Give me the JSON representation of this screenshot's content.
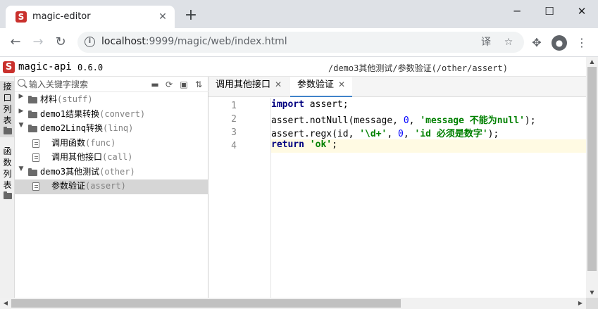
{
  "browser": {
    "tab_title": "magic-editor",
    "tab_favicon": "S",
    "tab_close": "✕",
    "new_tab": "+",
    "window_minimize": "─",
    "window_maximize": "☐",
    "window_close": "✕",
    "nav_back": "←",
    "nav_forward": "→",
    "nav_reload": "↻",
    "url_host": "localhost",
    "url_path": ":9999/magic/web/index.html",
    "translate_icon": "译",
    "bookmark_icon": "☆",
    "extensions_icon": "✥",
    "menu_icon": "⋮"
  },
  "app": {
    "logo": "S",
    "name": "magic-api",
    "version": "0.6.0",
    "current_path": "/demo3其他测试/参数验证(/other/assert)"
  },
  "rail": {
    "tabs": [
      {
        "label": [
          "接",
          "口",
          "列",
          "表"
        ],
        "active": true
      },
      {
        "label": [
          "函",
          "数",
          "列",
          "表"
        ],
        "active": false
      }
    ]
  },
  "tree": {
    "search_placeholder": "输入关键字搜索",
    "tools": [
      "new-folder-icon",
      "refresh-icon",
      "collapse-all-icon",
      "sort-icon"
    ],
    "tool_glyphs": [
      "▬",
      "⟳",
      "▣",
      "⇅"
    ],
    "caret_collapsed": "▶",
    "caret_expanded": "▼",
    "items": [
      {
        "type": "folder",
        "expanded": false,
        "level": 0,
        "name": "材料",
        "path": "(stuff)"
      },
      {
        "type": "folder",
        "expanded": false,
        "level": 0,
        "name": "demo1结果转换",
        "path": "(convert)"
      },
      {
        "type": "folder",
        "expanded": true,
        "level": 0,
        "name": "demo2Linq转换",
        "path": "(linq)"
      },
      {
        "type": "file",
        "level": 1,
        "name": "调用函数",
        "path": "(func)"
      },
      {
        "type": "file",
        "level": 1,
        "name": "调用其他接口",
        "path": "(call)"
      },
      {
        "type": "folder",
        "expanded": true,
        "level": 0,
        "name": "demo3其他测试",
        "path": "(other)"
      },
      {
        "type": "file",
        "level": 1,
        "name": "参数验证",
        "path": "(assert)",
        "selected": true
      }
    ]
  },
  "editor": {
    "tabs": [
      {
        "label": "调用其他接口",
        "active": false
      },
      {
        "label": "参数验证",
        "active": true
      }
    ],
    "tab_close": "✕",
    "lines": [
      {
        "no": "1",
        "tokens": [
          {
            "t": "import",
            "c": "kw"
          },
          {
            "t": " assert;",
            "c": ""
          }
        ]
      },
      {
        "no": "2",
        "tokens": [
          {
            "t": "assert.notNull(message, ",
            "c": ""
          },
          {
            "t": "0",
            "c": "num"
          },
          {
            "t": ", ",
            "c": ""
          },
          {
            "t": "'message 不能为null'",
            "c": "str"
          },
          {
            "t": ");",
            "c": ""
          }
        ]
      },
      {
        "no": "3",
        "tokens": [
          {
            "t": "assert.regx(id, ",
            "c": ""
          },
          {
            "t": "'\\d+'",
            "c": "str"
          },
          {
            "t": ", ",
            "c": ""
          },
          {
            "t": "0",
            "c": "num"
          },
          {
            "t": ", ",
            "c": ""
          },
          {
            "t": "'id 必须是数字'",
            "c": "str"
          },
          {
            "t": ");",
            "c": ""
          }
        ]
      },
      {
        "no": "4",
        "tokens": [
          {
            "t": "return",
            "c": "kw"
          },
          {
            "t": " ",
            "c": ""
          },
          {
            "t": "'ok'",
            "c": "str"
          },
          {
            "t": ";",
            "c": ""
          }
        ],
        "current": true
      }
    ]
  },
  "scrollbars": {
    "arrow_up": "▲",
    "arrow_down": "▼",
    "arrow_left": "◀",
    "arrow_right": "▶"
  },
  "colors": {
    "logo_red": "#c9302c",
    "keyword": "#000080",
    "string": "#008000",
    "number": "#0000ff",
    "active_tab_underline": "#4083c9",
    "selected_row": "#d6d6d6",
    "current_line": "#fffae3"
  }
}
